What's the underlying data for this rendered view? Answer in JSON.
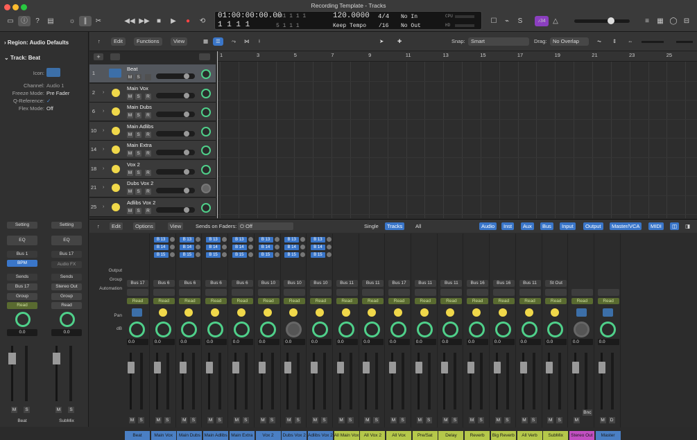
{
  "window": {
    "title": "Recording Template - Tracks"
  },
  "lcd": {
    "time": "01:00:00:00.00",
    "bars": "1  1  1  1",
    "subtop": "001  1  1  1",
    "subbot": "5  1  1  1",
    "tempo": "120.0000",
    "tempo_mode": "Keep Tempo",
    "sig": "4/4",
    "div": "/16",
    "in": "No In",
    "out": "No Out",
    "cpu": "CPU",
    "hd": "HD"
  },
  "badge": "♪34",
  "inspector": {
    "region": "Region: Audio Defaults",
    "track": "Track:",
    "track_name": "Beat",
    "icon_label": "Icon:",
    "channel_k": "Channel:",
    "channel_v": "Audio 1",
    "freeze_k": "Freeze Mode:",
    "freeze_v": "Pre Fader",
    "qref_k": "Q-Reference:",
    "qref_v": "✓",
    "flex_k": "Flex Mode:",
    "flex_v": "Off",
    "left_strip": {
      "setting": "Setting",
      "eq": "EQ",
      "bus": "Bus 1",
      "bpm": "BPM",
      "sends": "Sends",
      "out": "Bus 17",
      "group": "Group",
      "read": "Read",
      "db": "0.0",
      "m": "M",
      "s": "S",
      "i": "I",
      "name": "Beat"
    },
    "right_strip": {
      "setting": "Setting",
      "eq": "EQ",
      "bus": "Bus 17",
      "fx": "Audio FX",
      "sends": "Sends",
      "out": "Stereo Out",
      "group": "Group",
      "read": "Read",
      "db": "0.0",
      "m": "M",
      "s": "S",
      "name": "SubMix"
    }
  },
  "tracks_toolbar": {
    "edit": "Edit",
    "functions": "Functions",
    "view": "View",
    "snap_label": "Snap:",
    "snap": "Smart",
    "drag_label": "Drag:",
    "drag": "No Overlap"
  },
  "ruler": [
    "1",
    "3",
    "5",
    "7",
    "9",
    "11",
    "13",
    "15",
    "17",
    "19",
    "21",
    "23",
    "25"
  ],
  "tracks": [
    {
      "num": "1",
      "name": "Beat",
      "m": "M",
      "s": "S"
    },
    {
      "num": "2",
      "name": "Main Vox",
      "m": "M",
      "s": "S",
      "r": "R"
    },
    {
      "num": "6",
      "name": "Main Dubs",
      "m": "M",
      "s": "S",
      "r": "R"
    },
    {
      "num": "10",
      "name": "Main Adlibs",
      "m": "M",
      "s": "S",
      "r": "R"
    },
    {
      "num": "14",
      "name": "Main Extra",
      "m": "M",
      "s": "S",
      "r": "R"
    },
    {
      "num": "18",
      "name": "Vox 2",
      "m": "M",
      "s": "S",
      "r": "R"
    },
    {
      "num": "21",
      "name": "Dubs Vox 2",
      "m": "M",
      "s": "S",
      "r": "R"
    },
    {
      "num": "25",
      "name": "Adlibs Vox 2",
      "m": "M",
      "s": "S",
      "r": "R"
    }
  ],
  "mixer_toolbar": {
    "edit": "Edit",
    "options": "Options",
    "view": "View",
    "sends_label": "Sends on Faders:",
    "sends_value": "Off",
    "single": "Single",
    "tracks": "Tracks",
    "all": "All",
    "filters": [
      "Audio",
      "Inst",
      "Aux",
      "Bus",
      "Input",
      "Output",
      "Master/VCA",
      "MIDI"
    ]
  },
  "mixer_labels": {
    "output": "Output",
    "group": "Group",
    "automation": "Automation",
    "pan": "Pan",
    "db": "dB"
  },
  "strips": [
    {
      "name": "Beat",
      "out": "Bus 17",
      "buses": [],
      "read": "Read",
      "db": "0.0",
      "m": "M",
      "s": "S",
      "color": "#4a7fc4",
      "icon": "audio"
    },
    {
      "name": "Main Vox",
      "out": "Bus 6",
      "buses": [
        "B 13",
        "B 14",
        "B 15"
      ],
      "read": "Read",
      "db": "0.0",
      "m": "M",
      "s": "S",
      "color": "#4a7fc4",
      "icon": "yellow"
    },
    {
      "name": "Main Dubs",
      "out": "Bus 6",
      "buses": [
        "B 13",
        "B 14",
        "B 15"
      ],
      "read": "Read",
      "db": "0.0",
      "m": "M",
      "s": "S",
      "color": "#4a7fc4",
      "icon": "yellow"
    },
    {
      "name": "Main Adlibs",
      "out": "Bus 6",
      "buses": [
        "B 13",
        "B 14",
        "B 15"
      ],
      "read": "Read",
      "db": "0.0",
      "m": "M",
      "s": "S",
      "color": "#4a7fc4",
      "icon": "yellow"
    },
    {
      "name": "Main Extra",
      "out": "Bus 6",
      "buses": [
        "B 13",
        "B 14",
        "B 15"
      ],
      "read": "Read",
      "db": "0.0",
      "m": "M",
      "s": "S",
      "color": "#4a7fc4",
      "icon": "yellow"
    },
    {
      "name": "Vox 2",
      "out": "Bus 10",
      "buses": [
        "B 13",
        "B 14",
        "B 15"
      ],
      "read": "Read",
      "db": "0.0",
      "m": "M",
      "s": "S",
      "color": "#4a7fc4",
      "icon": "yellow"
    },
    {
      "name": "Dubs Vox 2",
      "out": "Bus 10",
      "buses": [
        "B 13",
        "B 14",
        "B 15"
      ],
      "read": "Read",
      "db": "0.0",
      "m": "M",
      "s": "S",
      "color": "#4a7fc4",
      "icon": "yellow"
    },
    {
      "name": "Adlibs Vox 2",
      "out": "Bus 10",
      "buses": [
        "B 13",
        "B 14",
        "B 15"
      ],
      "read": "Read",
      "db": "0.0",
      "m": "M",
      "s": "S",
      "color": "#4a7fc4",
      "icon": "yellow"
    },
    {
      "name": "All Main Vox",
      "out": "Bus 11",
      "buses": [],
      "read": "Read",
      "db": "0.0",
      "m": "M",
      "s": "S",
      "color": "#b5c84a",
      "icon": "yellow"
    },
    {
      "name": "All Vox 2",
      "out": "Bus 11",
      "buses": [],
      "read": "Read",
      "db": "0.0",
      "m": "M",
      "s": "S",
      "color": "#b5c84a",
      "icon": "yellow"
    },
    {
      "name": "All Vox",
      "out": "Bus 17",
      "buses": [],
      "read": "Read",
      "db": "0.0",
      "m": "M",
      "s": "S",
      "color": "#b5c84a",
      "icon": "yellow"
    },
    {
      "name": "Pre/Sat",
      "out": "Bus 11",
      "buses": [],
      "read": "Read",
      "db": "0.0",
      "m": "M",
      "s": "S",
      "color": "#b5c84a",
      "icon": "yellow"
    },
    {
      "name": "Delay",
      "out": "Bus 11",
      "buses": [],
      "read": "Read",
      "db": "0.0",
      "m": "M",
      "s": "S",
      "color": "#b5c84a",
      "icon": "yellow"
    },
    {
      "name": "Reverb",
      "out": "Bus 16",
      "buses": [],
      "read": "Read",
      "db": "0.0",
      "m": "M",
      "s": "S",
      "color": "#b5c84a",
      "icon": "yellow"
    },
    {
      "name": "Big Reverb",
      "out": "Bus 16",
      "buses": [],
      "read": "Read",
      "db": "0.0",
      "m": "M",
      "s": "S",
      "color": "#b5c84a",
      "icon": "yellow"
    },
    {
      "name": "All Verb",
      "out": "Bus 11",
      "buses": [],
      "read": "Read",
      "db": "0.0",
      "m": "M",
      "s": "S",
      "color": "#b5c84a",
      "icon": "yellow"
    },
    {
      "name": "SubMix",
      "out": "St Out",
      "buses": [],
      "read": "Read",
      "db": "0.0",
      "m": "M",
      "s": "S",
      "color": "#b5c84a",
      "icon": "yellow"
    },
    {
      "name": "Stereo Out",
      "out": "",
      "buses": [],
      "read": "Read",
      "db": "0.0",
      "m": "M",
      "s": "Bnc",
      "color": "#c24fc2",
      "icon": "audio"
    },
    {
      "name": "Master",
      "out": "",
      "buses": [],
      "read": "Read",
      "db": "0.0",
      "m": "M",
      "s": "D",
      "color": "#4a7fc4",
      "icon": "audio"
    }
  ],
  "colors": {
    "accent": "#3a76c9",
    "pan_ring": "#4fd08a",
    "read": "#596a30"
  }
}
